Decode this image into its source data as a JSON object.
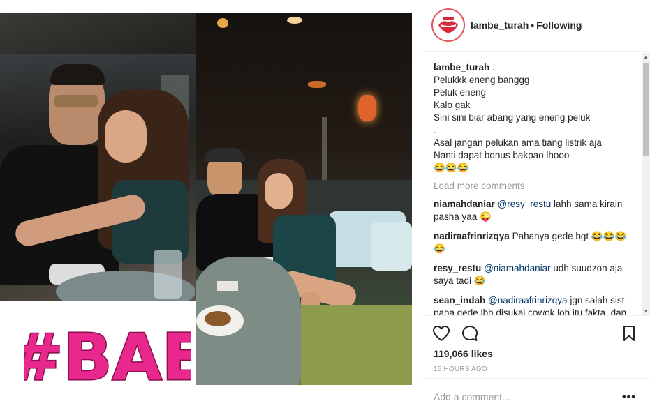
{
  "header": {
    "username": "lambe_turah",
    "separator": "•",
    "follow_status": "Following",
    "avatar_icon": "lips-logo-icon"
  },
  "caption": {
    "username": "lambe_turah",
    "first_text": ".",
    "lines": [
      "Pelukkk eneng banggg",
      "Peluk eneng",
      "Kalo gak",
      "Sini sini biar abang yang eneng peluk",
      ".",
      "Asal jangan pelukan ama tiang listrik aja",
      "Nanti dapat bonus bakpao lhooo",
      "😂😂😂"
    ]
  },
  "load_more": "Load more comments",
  "comments": [
    {
      "user": "niamahdaniar",
      "mention": "@resy_restu",
      "text": "lahh sama kirain pasha yaa 😜"
    },
    {
      "user": "nadiraafrinrizqya",
      "mention": "",
      "text": "Pahanya gede bgt 😂😂😂😂"
    },
    {
      "user": "resy_restu",
      "mention": "@niamahdaniar",
      "text": "udh suudzon aja saya tadi 😂"
    },
    {
      "user": "sean_indah",
      "mention": "@nadiraafrinrizqya",
      "text": "jgn salah sist paha gede lbh disukai cowok loh itu fakta. dan kemungkinan terkena kangker"
    }
  ],
  "actions": {
    "like_icon": "heart-icon",
    "comment_icon": "speech-bubble-icon",
    "save_icon": "bookmark-icon"
  },
  "likes_text": "119,066 likes",
  "time_text": "15 HOURS AGO",
  "add_comment": {
    "placeholder": "Add a comment...",
    "more_label": "•••"
  },
  "sticker": {
    "text": "#BAE",
    "color": "#e8288c"
  },
  "colors": {
    "accent_red": "#e2585e",
    "mention_blue": "#003569",
    "muted": "#999999"
  }
}
